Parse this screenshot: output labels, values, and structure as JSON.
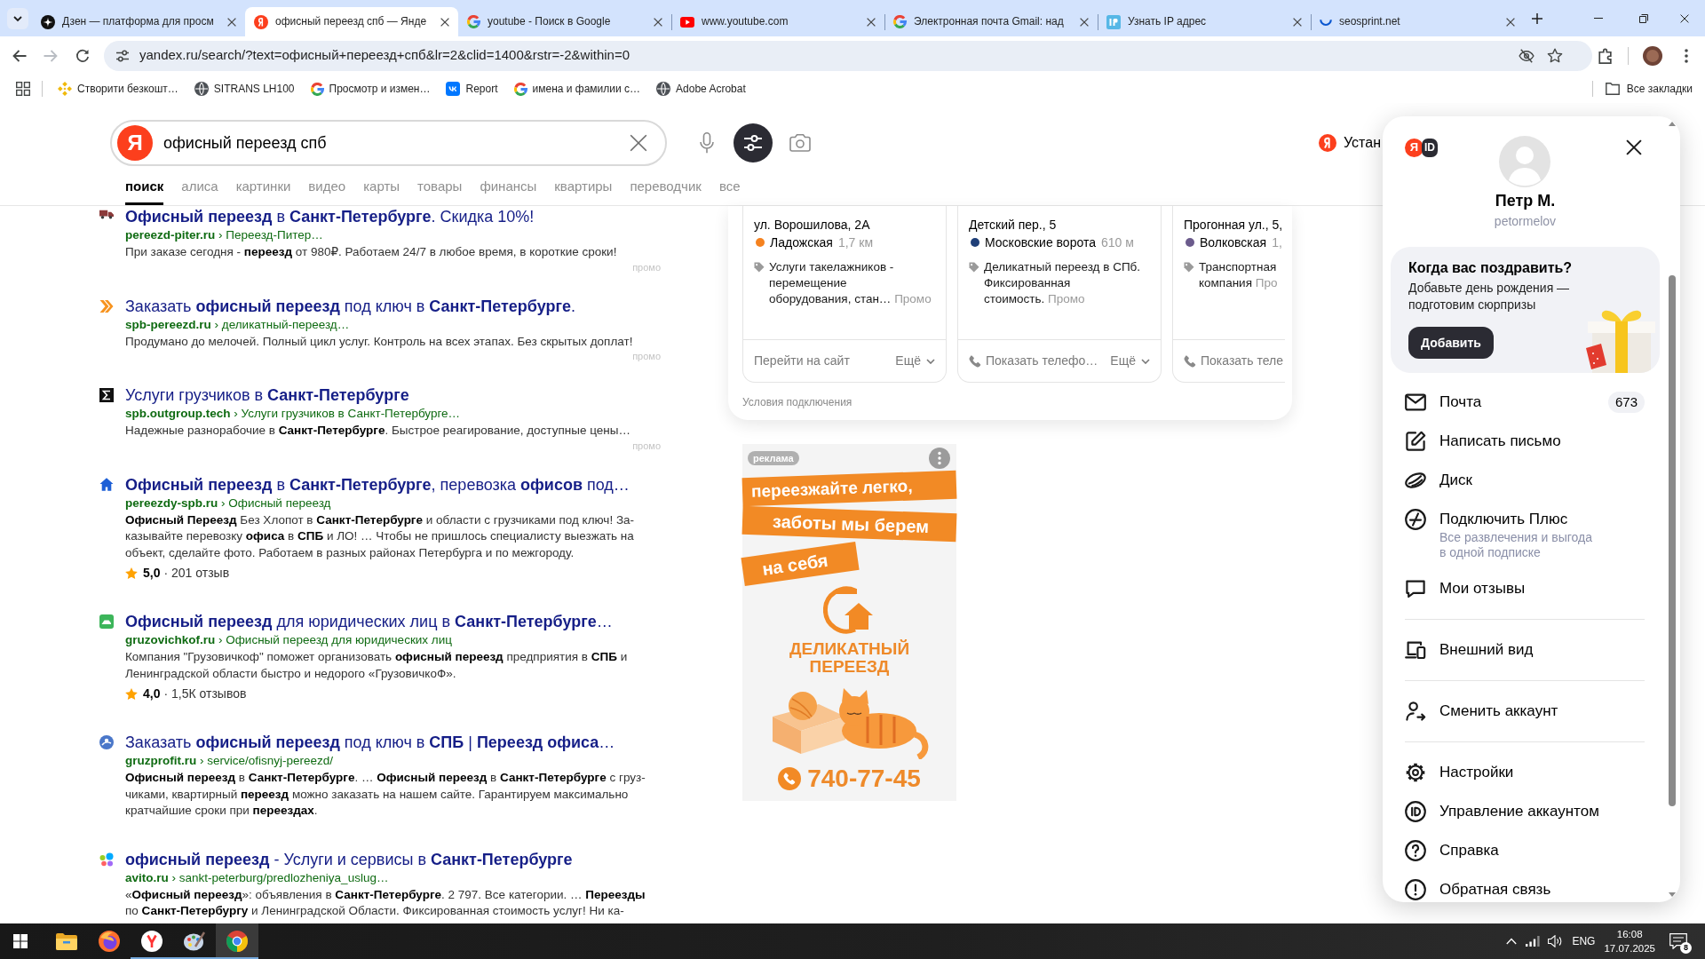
{
  "browser": {
    "tabs": [
      {
        "kind": "dzen",
        "title": "Дзен — платформа для просм",
        "selected": false
      },
      {
        "kind": "yandex",
        "title": "офисный переезд спб — Янде",
        "selected": true
      },
      {
        "kind": "google",
        "title": "youtube - Поиск в Google",
        "selected": false
      },
      {
        "kind": "youtube",
        "title": "www.youtube.com",
        "selected": false
      },
      {
        "kind": "google",
        "title": "Электронная почта Gmail: над",
        "selected": false
      },
      {
        "kind": "ip",
        "title": "Узнать IP адрес",
        "selected": false
      },
      {
        "kind": "loading",
        "title": "seosprint.net",
        "selected": false
      }
    ],
    "nav": {
      "back_enabled": true,
      "forward_enabled": false
    },
    "address": "yandex.ru/search/?text=офисный+переезд+спб&lr=2&clid=1400&rstr=-2&within=0",
    "bookmarks": [
      {
        "kind": "diamond",
        "label": "Створити безкошт…"
      },
      {
        "kind": "globe",
        "label": "SITRANS LH100"
      },
      {
        "kind": "google",
        "label": "Просмотр и измен…"
      },
      {
        "kind": "tile",
        "label": "Report"
      },
      {
        "kind": "google",
        "label": "имена и фамилии с…"
      },
      {
        "kind": "globe",
        "label": "Adobe Acrobat"
      }
    ],
    "all_bookmarks": "Все закладки"
  },
  "search": {
    "logo": "Я",
    "query": "офисный переезд спб",
    "install": "Устан",
    "verticals": [
      {
        "label": "поиск",
        "selected": true
      },
      {
        "label": "алиса",
        "selected": false
      },
      {
        "label": "картинки",
        "selected": false
      },
      {
        "label": "видео",
        "selected": false
      },
      {
        "label": "карты",
        "selected": false
      },
      {
        "label": "товары",
        "selected": false
      },
      {
        "label": "финансы",
        "selected": false
      },
      {
        "label": "квартиры",
        "selected": false
      },
      {
        "label": "переводчик",
        "selected": false
      },
      {
        "label": "все",
        "selected": false
      }
    ]
  },
  "results": [
    {
      "kind": "truck",
      "title": "**Офисный переезд** в **Санкт-Петербурге**. Скидка 10%!",
      "url": "**pereezd-piter.ru** › Переезд-Питер…",
      "snippet": "При заказе сегодня - **переезд** от 980₽. Работаем 24/7 в любое время, в короткие сроки!",
      "promo": "промо"
    },
    {
      "kind": "chevrons",
      "title": "Заказать **офисный переезд** под ключ в **Санкт-Петербурге**.",
      "url": "**spb-pereezd.ru** › деликатный-переезд…",
      "snippet": "Продумано до мелочей. Полный цикл услуг. Контроль на всех этапах. Без скрытых доплат!",
      "promo": "промо"
    },
    {
      "kind": "square",
      "title": "Услуги грузчиков в **Санкт-Петербурге**",
      "url": "**spb.outgroup.tech** › Услуги грузчиков в Санкт-Петербурге…",
      "snippet": "Надежные разнорабочие в **Санкт-Петербурге**. Быстрое реагирование, доступные цены…",
      "promo": "промо"
    },
    {
      "kind": "house",
      "title": "**Офисный переезд** в **Санкт-Петербурге**, перевозка **офисов** под…",
      "url": "**pereezdy-spb.ru** › Офисный переезд",
      "snippet": "**Офисный Переезд** Без Хлопот в **Санкт-Петербурге** и области с грузчиками под ключ! За-\nказывайте перевозку **офиса** в **СПБ** и ЛО! … Чтобы не пришлось специалисту выезжать на\nобъект, сделайте фото. Работаем в разных районах Петербурга и по межгороду.",
      "rating": {
        "score": "5,0",
        "reviews": "· 201 отзыв"
      }
    },
    {
      "kind": "tile",
      "title": "**Офисный переезд** для юридических лиц в **Санкт-Петербурге**…",
      "url": "**gruzovichkof.ru** › Офисный переезд для юридических лиц",
      "snippet": "Компания \"Грузовичкоф\" поможет организовать **офисный переезд** предприятия в **СПБ** и\nЛенинградской области быстро и недорого «ГрузовичкоФ».",
      "rating": {
        "score": "4,0",
        "reviews": "· 1,5К отзывов"
      }
    },
    {
      "kind": "badge",
      "title": "Заказать **офисный переезд** под ключ в **СПБ** | **Переезд офиса**…",
      "url": "**gruzprofit.ru** › service/ofisnyj-pereezd/",
      "snippet": "**Офисный переезд** в **Санкт-Петербурге**. … **Офисный переезд** в **Санкт-Петербурге** с груз-\nчиками, квартирный **переезд** можно заказать на нашем сайте. Гарантируем максимально\nкратчайшие сроки при **переездах**."
    },
    {
      "kind": "dots",
      "title": "**офисный переезд** - Услуги и сервисы в **Санкт-Петербурге**",
      "url": "**avito.ru** › sankt-peterburg/predlozheniya_uslug…",
      "snippet": "«**Офисный переезд**»: объявления в **Санкт-Петербурге**. 2 797. Все категории. … **Переезды**\nпо **Санкт-Петербургу** и Ленинградской Области. Фиксированная стоимость услуг! Ни ка-"
    }
  ],
  "places": {
    "cards": [
      {
        "address": "ул. Ворошилова, 2А",
        "metro": "Ладожская",
        "distance": "1,7 км",
        "color": "#f5821f",
        "description": "Услуги такелажников -\nперемещение\nоборудования, стан…",
        "promo": "Промо",
        "action": {
          "kind": "link",
          "label": "Перейти на сайт"
        },
        "more": "Ещё"
      },
      {
        "address": "Детский пер., 5",
        "metro": "Московские ворота",
        "distance": "610 м",
        "color": "#1f3f78",
        "description": "Деликатный переезд в СПб.\nФиксированная\nстоимость.",
        "promo": "Промо",
        "action": {
          "kind": "phone",
          "label": "Показать телефо…"
        },
        "more": "Ещё"
      },
      {
        "address": "Прогонная ул., 5,",
        "metro": "Волковская",
        "distance": "1,",
        "color": "#6b5b8c",
        "description": "Транспортная\nкомпания",
        "promo": "Про",
        "action": {
          "kind": "phone",
          "label": "Показать теле"
        }
      }
    ],
    "note": "Условия подключения"
  },
  "ad": {
    "label": "реклама",
    "slogan": [
      "переезжайте легко,",
      "заботы мы берем",
      "на себя"
    ],
    "brand": "ДЕЛИКАТНЫЙ\nПЕРЕЕЗД",
    "phone": "740-77-45"
  },
  "account": {
    "logo": {
      "letter": "Я",
      "tag": "ID"
    },
    "name": "Петр М.",
    "login": "petormelov",
    "promo": {
      "title": "Когда вас поздравить?",
      "text": "Добавьте день рождения —\nподготовим сюрпризы",
      "button": "Добавить"
    },
    "sections": [
      [
        {
          "kind": "mail",
          "label": "Почта",
          "count": "673"
        },
        {
          "kind": "edit",
          "label": "Написать письмо"
        },
        {
          "kind": "disk",
          "label": "Диск"
        },
        {
          "kind": "plus",
          "label": "Подключить Плюс",
          "subtitle": "Все развлечения и выгода\nв одной подписке"
        },
        {
          "kind": "reviews",
          "label": "Мои отзывы"
        }
      ],
      [
        {
          "kind": "appearance",
          "label": "Внешний вид"
        }
      ],
      [
        {
          "kind": "switch",
          "label": "Сменить аккаунт"
        }
      ],
      [
        {
          "kind": "settings",
          "label": "Настройки"
        },
        {
          "kind": "id",
          "label": "Управление аккаунтом"
        },
        {
          "kind": "help",
          "label": "Справка"
        },
        {
          "kind": "feedback",
          "label": "Обратная связь"
        }
      ]
    ]
  },
  "taskbar": {
    "apps": [
      {
        "kind": "folder",
        "running": false,
        "selected": false
      },
      {
        "kind": "flame",
        "running": false,
        "selected": false
      },
      {
        "kind": "letter",
        "running": true,
        "selected": false
      },
      {
        "kind": "palette",
        "running": true,
        "selected": false
      },
      {
        "kind": "ring",
        "running": true,
        "selected": true
      }
    ],
    "language": "ENG",
    "time": "16:08",
    "date": "17.07.2025",
    "notifications": "8"
  }
}
